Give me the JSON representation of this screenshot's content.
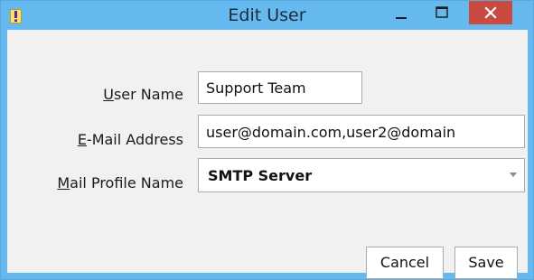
{
  "window": {
    "title": "Edit User",
    "accent_color": "#66b9ef",
    "close_color": "#c94a3f",
    "icons": [
      "app-icon",
      "minimize-icon",
      "maximize-icon",
      "close-icon"
    ]
  },
  "form": {
    "user_name": {
      "label_accel": "U",
      "label_rest": "ser Name",
      "value": "Support Team"
    },
    "email": {
      "label_accel": "E",
      "label_rest": "-Mail Address",
      "value": "user@domain.com,user2@domain"
    },
    "mail_profile": {
      "label_accel": "M",
      "label_rest": "ail Profile Name",
      "selected": "SMTP Server"
    }
  },
  "buttons": {
    "cancel": "Cancel",
    "save": "Save"
  }
}
